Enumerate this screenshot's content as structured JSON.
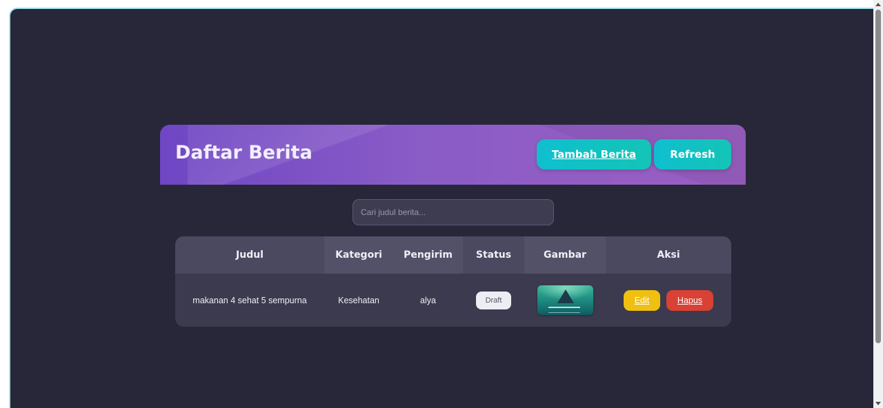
{
  "header": {
    "title": "Daftar Berita",
    "add_label": "Tambah Berita",
    "refresh_label": "Refresh"
  },
  "search": {
    "placeholder": "Cari judul berita...",
    "value": ""
  },
  "table": {
    "columns": [
      "Judul",
      "Kategori",
      "Pengirim",
      "Status",
      "Gambar",
      "Aksi"
    ],
    "rows": [
      {
        "judul": "makanan 4 sehat 5 sempurna",
        "kategori": "Kesehatan",
        "pengirim": "alya",
        "status": "Draft",
        "gambar": "news-thumbnail",
        "edit_label": "Edit",
        "hapus_label": "Hapus"
      }
    ]
  },
  "colors": {
    "background": "#272739",
    "header_gradient_start": "#6f46c4",
    "header_gradient_end": "#9a5fc2",
    "accent_teal": "#14c4b6",
    "edit_yellow": "#f0c010",
    "delete_red": "#d94135"
  }
}
